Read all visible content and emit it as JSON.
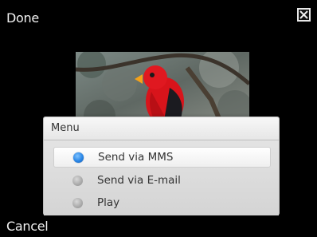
{
  "softkeys": {
    "top_left": "Done",
    "bottom_left": "Cancel"
  },
  "close_icon": "close-icon",
  "photo_description_icon": "photo-thumbnail",
  "menu": {
    "title": "Menu",
    "items": [
      {
        "label": "Send via MMS",
        "selected": true
      },
      {
        "label": "Send via E-mail",
        "selected": false
      },
      {
        "label": "Play",
        "selected": false
      }
    ]
  },
  "colors": {
    "background": "#000000",
    "accent_radio": "#2a86e6",
    "menu_bg": "#e0e0e0"
  }
}
